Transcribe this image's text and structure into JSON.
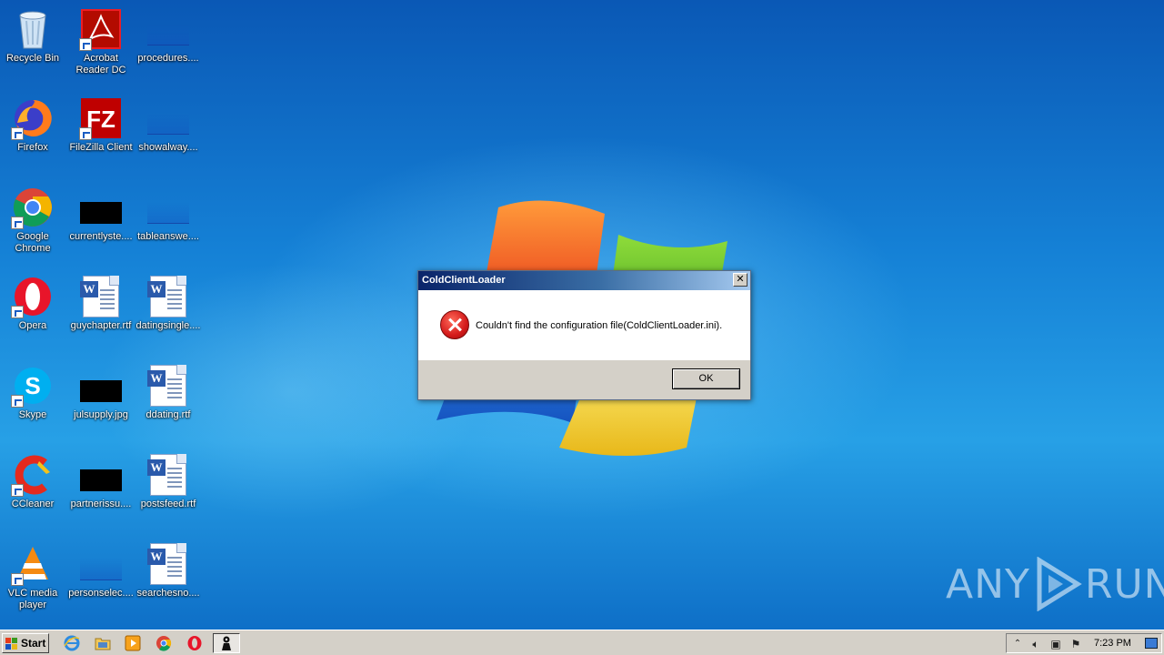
{
  "desktop": {
    "icons": [
      {
        "label": "Recycle Bin",
        "icon": "recycle-bin-icon"
      },
      {
        "label": "Acrobat Reader DC",
        "icon": "acrobat-reader-icon"
      },
      {
        "label": "procedures....",
        "icon": "file-thumbnail-icon"
      },
      {
        "label": "Firefox",
        "icon": "firefox-icon"
      },
      {
        "label": "FileZilla Client",
        "icon": "filezilla-icon"
      },
      {
        "label": "showalway....",
        "icon": "file-thumbnail-icon"
      },
      {
        "label": "Google Chrome",
        "icon": "chrome-icon"
      },
      {
        "label": "currentlyste....",
        "icon": "image-thumbnail-icon"
      },
      {
        "label": "tableanswe....",
        "icon": "file-thumbnail-icon"
      },
      {
        "label": "Opera",
        "icon": "opera-icon"
      },
      {
        "label": "guychapter.rtf",
        "icon": "word-document-icon"
      },
      {
        "label": "datingsingle....",
        "icon": "word-document-icon"
      },
      {
        "label": "Skype",
        "icon": "skype-icon"
      },
      {
        "label": "julsupply.jpg",
        "icon": "image-thumbnail-icon"
      },
      {
        "label": "ddating.rtf",
        "icon": "word-document-icon"
      },
      {
        "label": "CCleaner",
        "icon": "ccleaner-icon"
      },
      {
        "label": "partnerissu....",
        "icon": "image-thumbnail-icon"
      },
      {
        "label": "postsfeed.rtf",
        "icon": "word-document-icon"
      },
      {
        "label": "VLC media player",
        "icon": "vlc-icon"
      },
      {
        "label": "personselec....",
        "icon": "file-thumbnail-icon"
      },
      {
        "label": "searchesno....",
        "icon": "word-document-icon"
      }
    ]
  },
  "dialog": {
    "title": "ColdClientLoader",
    "close_label": "✕",
    "message": "Couldn't find the configuration file(ColdClientLoader.ini).",
    "ok_label": "OK",
    "icon": "error-icon"
  },
  "watermark": {
    "text_left": "ANY",
    "text_right": "RUN"
  },
  "taskbar": {
    "start_label": "Start",
    "items": [
      "internet-explorer-icon",
      "folder-icon",
      "media-player-icon",
      "chrome-icon",
      "opera-icon",
      "app-icon"
    ],
    "clock": "7:23 PM"
  },
  "colors": {
    "desktop_blue": "#1277c9",
    "taskbar_gray": "#d4d0c8",
    "titlebar_dark": "#0a246a",
    "error_red": "#d41b1b"
  }
}
